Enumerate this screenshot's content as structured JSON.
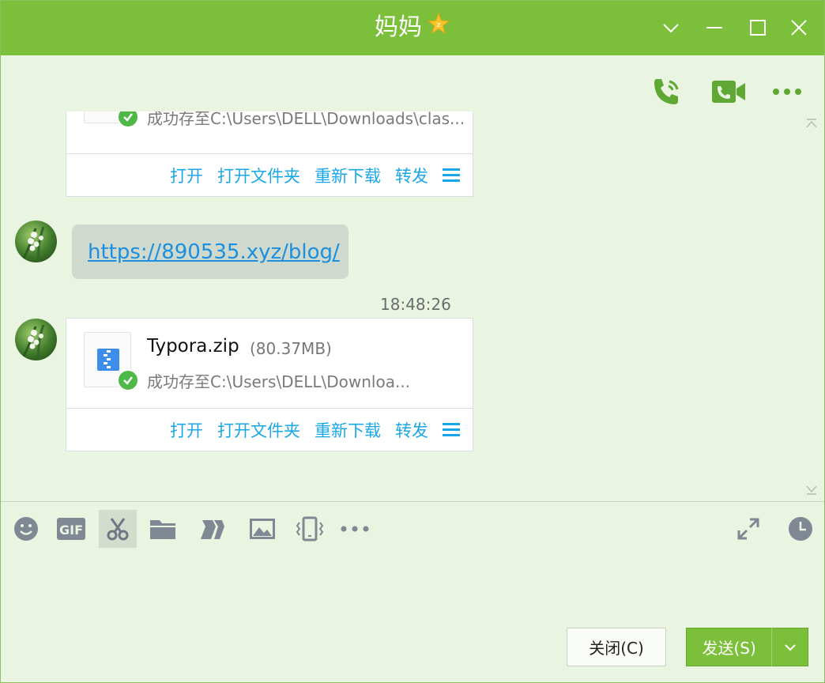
{
  "window": {
    "title": "妈妈",
    "title_badge": "star-badge-icon",
    "accent": "#7bbf3a",
    "controls": [
      "chevron-down-icon",
      "minimize-icon",
      "maximize-icon",
      "close-icon"
    ]
  },
  "header_actions": [
    "phone-call-icon",
    "video-call-icon",
    "more-icon"
  ],
  "messages": {
    "top_file": {
      "status": "成功存至C:\\Users\\DELL\\Downloads\\clas...",
      "actions": [
        "打开",
        "打开文件夹",
        "重新下载",
        "转发"
      ]
    },
    "link_bubble": {
      "url": "https://890535.xyz/blog/"
    },
    "timestamp": "18:48:26",
    "file": {
      "name": "Typora.zip",
      "size": "(80.37MB)",
      "status": "成功存至C:\\Users\\DELL\\Downloa...",
      "actions": [
        "打开",
        "打开文件夹",
        "重新下载",
        "转发"
      ]
    }
  },
  "toolbar": [
    "emoji-icon",
    "gif-icon",
    "scissors-icon",
    "folder-icon",
    "shake-icon",
    "image-icon",
    "vibrate-icon",
    "more-tools-icon",
    "expand-icon",
    "history-icon"
  ],
  "buttons": {
    "close": "关闭(C)",
    "send": "发送(S)"
  }
}
